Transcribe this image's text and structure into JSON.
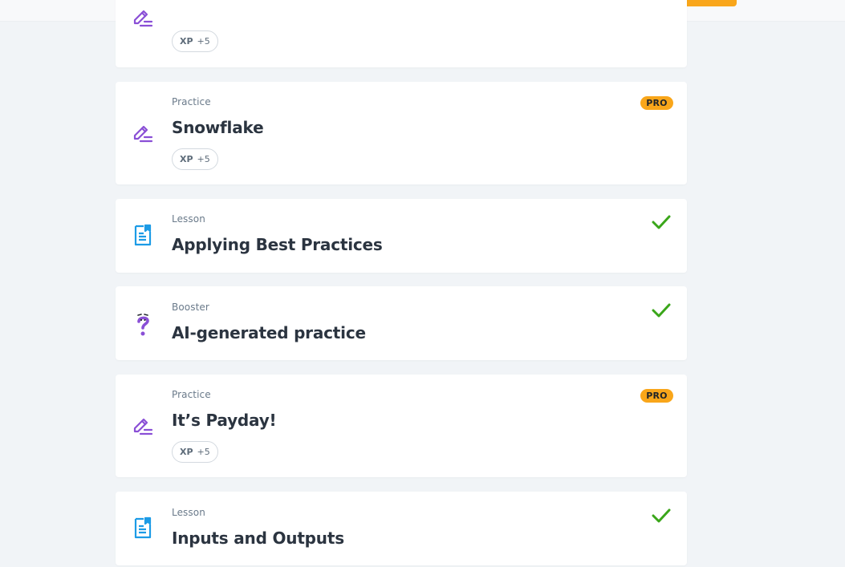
{
  "items": [
    {
      "xp_label": "XP",
      "xp_value": "+5"
    },
    {
      "type": "Practice",
      "title": "Snowflake",
      "badge": "PRO",
      "xp_label": "XP",
      "xp_value": "+5"
    },
    {
      "type": "Lesson",
      "title": "Applying Best Practices"
    },
    {
      "type": "Booster",
      "title": "AI-generated practice"
    },
    {
      "type": "Practice",
      "title": "It’s Payday!",
      "badge": "PRO",
      "xp_label": "XP",
      "xp_value": "+5"
    },
    {
      "type": "Lesson",
      "title": "Inputs and Outputs"
    }
  ],
  "icons": {
    "practice": "pencil-lines-icon",
    "lesson": "bookmark-document-icon",
    "booster": "question-mark-icon",
    "completed": "checkmark-icon"
  },
  "colors": {
    "background": "#f1f4f7",
    "card": "#ffffff",
    "pro_badge": "#f9a61a",
    "practice_icon": "#8a4fd6",
    "lesson_icon": "#1c9be6",
    "check": "#3aa61a",
    "title": "#2b3440",
    "type_label": "#6a7a8a"
  }
}
